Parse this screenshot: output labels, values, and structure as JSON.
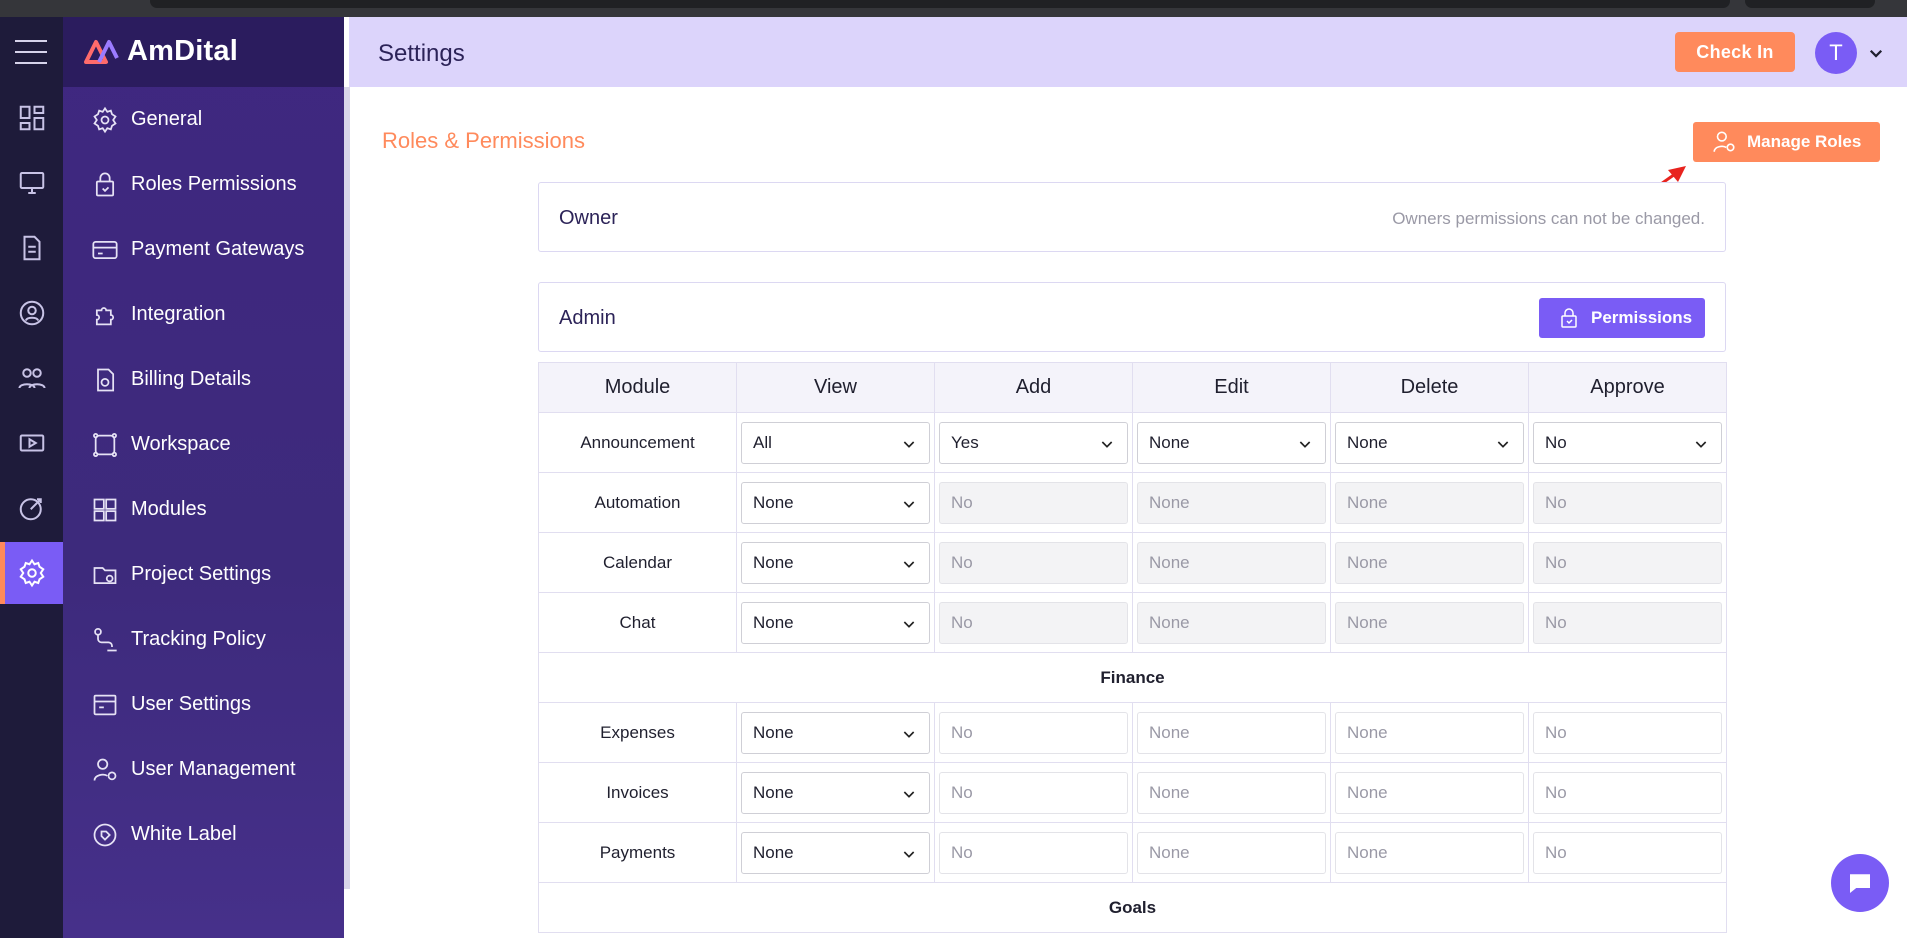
{
  "app": {
    "brand": "AmDital",
    "page_title": "Settings"
  },
  "colors": {
    "accent": "#7a5cf5",
    "orange": "#ff8a5c",
    "rail": "#1e1b3a",
    "sidebar": "#3f2780",
    "topbar": "#dcd4fb"
  },
  "header": {
    "checkin_label": "Check In",
    "avatar_initial": "T"
  },
  "sidebar": {
    "items": [
      {
        "label": "General",
        "icon": "gear-icon"
      },
      {
        "label": "Roles Permissions",
        "icon": "roles-icon"
      },
      {
        "label": "Payment Gateways",
        "icon": "card-icon"
      },
      {
        "label": "Integration",
        "icon": "puzzle-icon"
      },
      {
        "label": "Billing Details",
        "icon": "billing-icon"
      },
      {
        "label": "Workspace",
        "icon": "workspace-icon"
      },
      {
        "label": "Modules",
        "icon": "grid-icon"
      },
      {
        "label": "Project Settings",
        "icon": "folder-gear-icon"
      },
      {
        "label": "Tracking Policy",
        "icon": "route-icon"
      },
      {
        "label": "User Settings",
        "icon": "user-settings-icon"
      },
      {
        "label": "User Management",
        "icon": "user-gear-icon"
      },
      {
        "label": "White Label",
        "icon": "label-icon"
      }
    ]
  },
  "content": {
    "section_title": "Roles & Permissions",
    "manage_roles_label": "Manage Roles",
    "owner": {
      "title": "Owner",
      "note": "Owners permissions can not be changed."
    },
    "admin": {
      "title": "Admin",
      "permissions_label": "Permissions"
    }
  },
  "table": {
    "headers": [
      "Module",
      "View",
      "Add",
      "Edit",
      "Delete",
      "Approve"
    ],
    "announcement": {
      "module": "Announcement",
      "view": "All",
      "add": "Yes",
      "edit": "None",
      "delete": "None",
      "approve": "No"
    },
    "automation": {
      "module": "Automation",
      "view": "None",
      "add": "No",
      "edit": "None",
      "delete": "None",
      "approve": "No"
    },
    "calendar": {
      "module": "Calendar",
      "view": "None",
      "add": "No",
      "edit": "None",
      "delete": "None",
      "approve": "No"
    },
    "chat": {
      "module": "Chat",
      "view": "None",
      "add": "No",
      "edit": "None",
      "delete": "None",
      "approve": "No"
    },
    "finance_group": "Finance",
    "expenses": {
      "module": "Expenses",
      "view": "None",
      "add": "No",
      "edit": "None",
      "delete": "None",
      "approve": "No"
    },
    "invoices": {
      "module": "Invoices",
      "view": "None",
      "add": "No",
      "edit": "None",
      "delete": "None",
      "approve": "No"
    },
    "payments": {
      "module": "Payments",
      "view": "None",
      "add": "No",
      "edit": "None",
      "delete": "None",
      "approve": "No"
    },
    "goals_group": "Goals"
  }
}
